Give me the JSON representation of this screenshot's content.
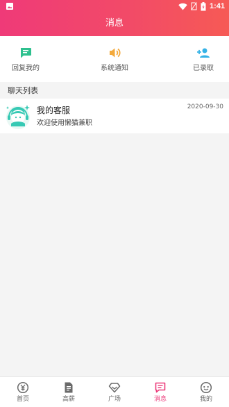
{
  "status_bar": {
    "time": "1:41"
  },
  "header": {
    "title": "消息"
  },
  "top_actions": [
    {
      "label": "回复我的",
      "icon": "reply-chat-icon",
      "color": "#2ec08e"
    },
    {
      "label": "系统通知",
      "icon": "speaker-icon",
      "color": "#f3a93b"
    },
    {
      "label": "已录取",
      "icon": "person-add-icon",
      "color": "#35b2e6"
    }
  ],
  "section": {
    "title": "聊天列表"
  },
  "chats": [
    {
      "name": "我的客服",
      "message": "欢迎使用懒猫兼职",
      "date": "2020-09-30"
    }
  ],
  "tabbar": [
    {
      "label": "首页",
      "icon": "yen-circle-icon",
      "active": false
    },
    {
      "label": "高薪",
      "icon": "document-icon",
      "active": false
    },
    {
      "label": "广场",
      "icon": "diamond-icon",
      "active": false
    },
    {
      "label": "消息",
      "icon": "message-icon",
      "active": true
    },
    {
      "label": "我的",
      "icon": "smiley-icon",
      "active": false
    }
  ],
  "colors": {
    "accent": "#ec3b7a",
    "header_start": "#ef3a78",
    "header_end": "#f65a55"
  }
}
